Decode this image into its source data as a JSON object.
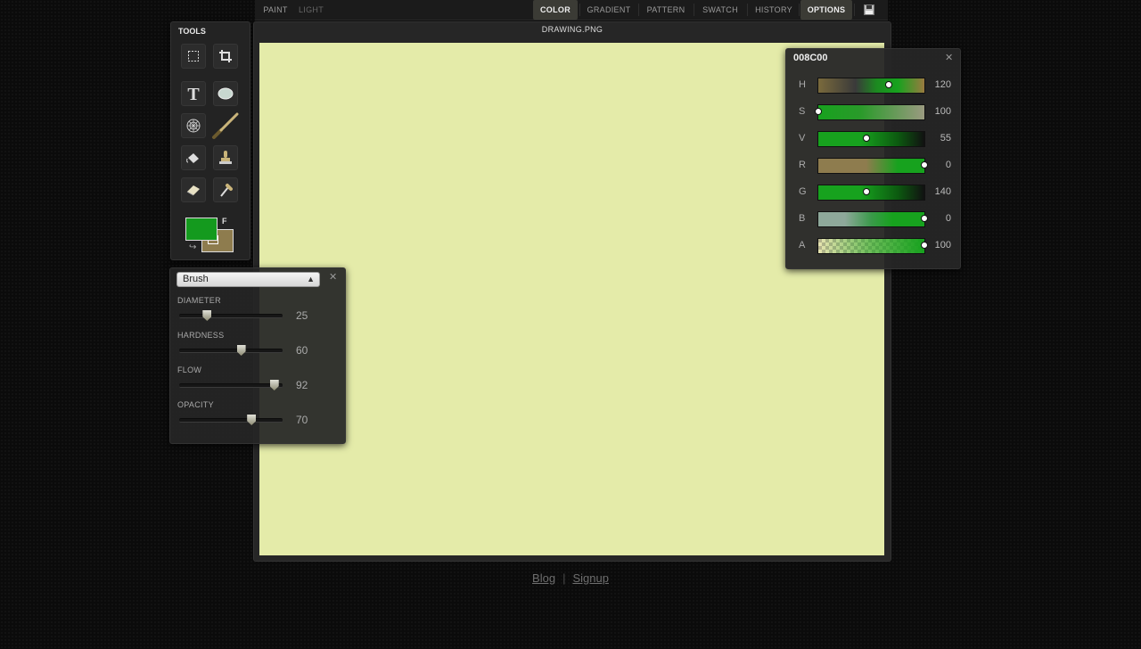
{
  "menu": {
    "left": [
      {
        "label": "PAINT",
        "state": "normal"
      },
      {
        "label": "LIGHT",
        "state": "dim"
      }
    ],
    "right": [
      {
        "label": "COLOR",
        "state": "active"
      },
      {
        "label": "GRADIENT",
        "state": "normal"
      },
      {
        "label": "PATTERN",
        "state": "normal"
      },
      {
        "label": "SWATCH",
        "state": "normal"
      },
      {
        "label": "HISTORY",
        "state": "normal"
      },
      {
        "label": "OPTIONS",
        "state": "active"
      }
    ],
    "save_icon": "floppy-disk-icon"
  },
  "tools": {
    "title": "TOOLS",
    "items": [
      {
        "name": "marquee-select",
        "icon": "dashed-rect-icon"
      },
      {
        "name": "crop",
        "icon": "crop-icon"
      },
      {
        "name": "text",
        "icon": "text-T-icon"
      },
      {
        "name": "ellipse",
        "icon": "ellipse-icon"
      },
      {
        "name": "spirograph",
        "icon": "spirograph-icon"
      },
      {
        "name": "brush",
        "icon": "paintbrush-icon",
        "active": true
      },
      {
        "name": "paint-bucket",
        "icon": "bucket-icon"
      },
      {
        "name": "stamp",
        "icon": "stamp-icon"
      },
      {
        "name": "eraser",
        "icon": "eraser-icon"
      },
      {
        "name": "eyedropper",
        "icon": "eyedropper-icon"
      }
    ],
    "foreground_color": "#149a1e",
    "background_color": "#8e7c4e",
    "swap_label": "F",
    "swap_icon": "swap-arrow-icon"
  },
  "document": {
    "title": "DRAWING.PNG",
    "canvas_color": "#e4eba9"
  },
  "brush_panel": {
    "selected": "Brush",
    "close_icon": "close-icon",
    "sliders": [
      {
        "label": "DIAMETER",
        "value": "25",
        "fraction": 0.27
      },
      {
        "label": "HARDNESS",
        "value": "60",
        "fraction": 0.6
      },
      {
        "label": "FLOW",
        "value": "92",
        "fraction": 0.92
      },
      {
        "label": "OPACITY",
        "value": "70",
        "fraction": 0.7
      }
    ]
  },
  "color_panel": {
    "hex": "008C00",
    "close_icon": "close-icon",
    "channels": [
      {
        "label": "H",
        "value": "120",
        "fraction": 0.66
      },
      {
        "label": "S",
        "value": "100",
        "fraction": 0.0
      },
      {
        "label": "V",
        "value": "55",
        "fraction": 0.45
      },
      {
        "label": "R",
        "value": "0",
        "fraction": 1.0
      },
      {
        "label": "G",
        "value": "140",
        "fraction": 0.45
      },
      {
        "label": "B",
        "value": "0",
        "fraction": 1.0
      },
      {
        "label": "A",
        "value": "100",
        "fraction": 1.0
      }
    ]
  },
  "footer": {
    "links": [
      "Blog",
      "Signup"
    ],
    "separator": "|"
  }
}
